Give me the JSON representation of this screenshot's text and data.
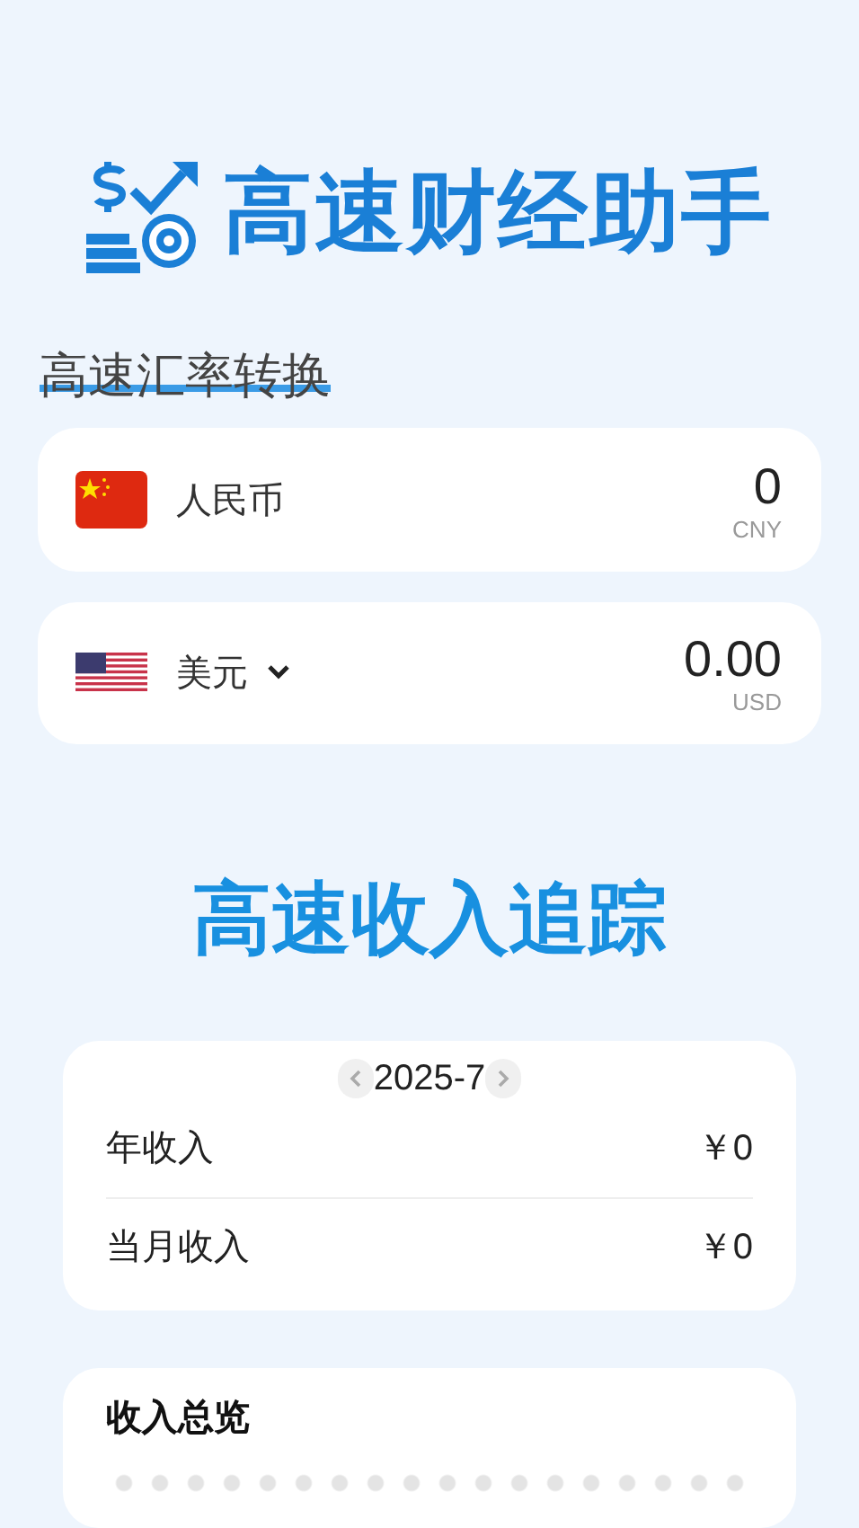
{
  "app_title": "高速财经助手",
  "converter": {
    "title": "高速汇率转换",
    "currencies": [
      {
        "kind": "cny",
        "name": "人民币",
        "amount": "0",
        "code": "CNY",
        "dropdown": false
      },
      {
        "kind": "usd",
        "name": "美元",
        "amount": "0.00",
        "code": "USD",
        "dropdown": true
      }
    ]
  },
  "income": {
    "title": "高速收入追踪",
    "month": "2025-7",
    "rows": [
      {
        "label": "年收入",
        "value": "￥0"
      },
      {
        "label": "当月收入",
        "value": "￥0"
      }
    ]
  },
  "overview": {
    "title": "收入总览"
  }
}
